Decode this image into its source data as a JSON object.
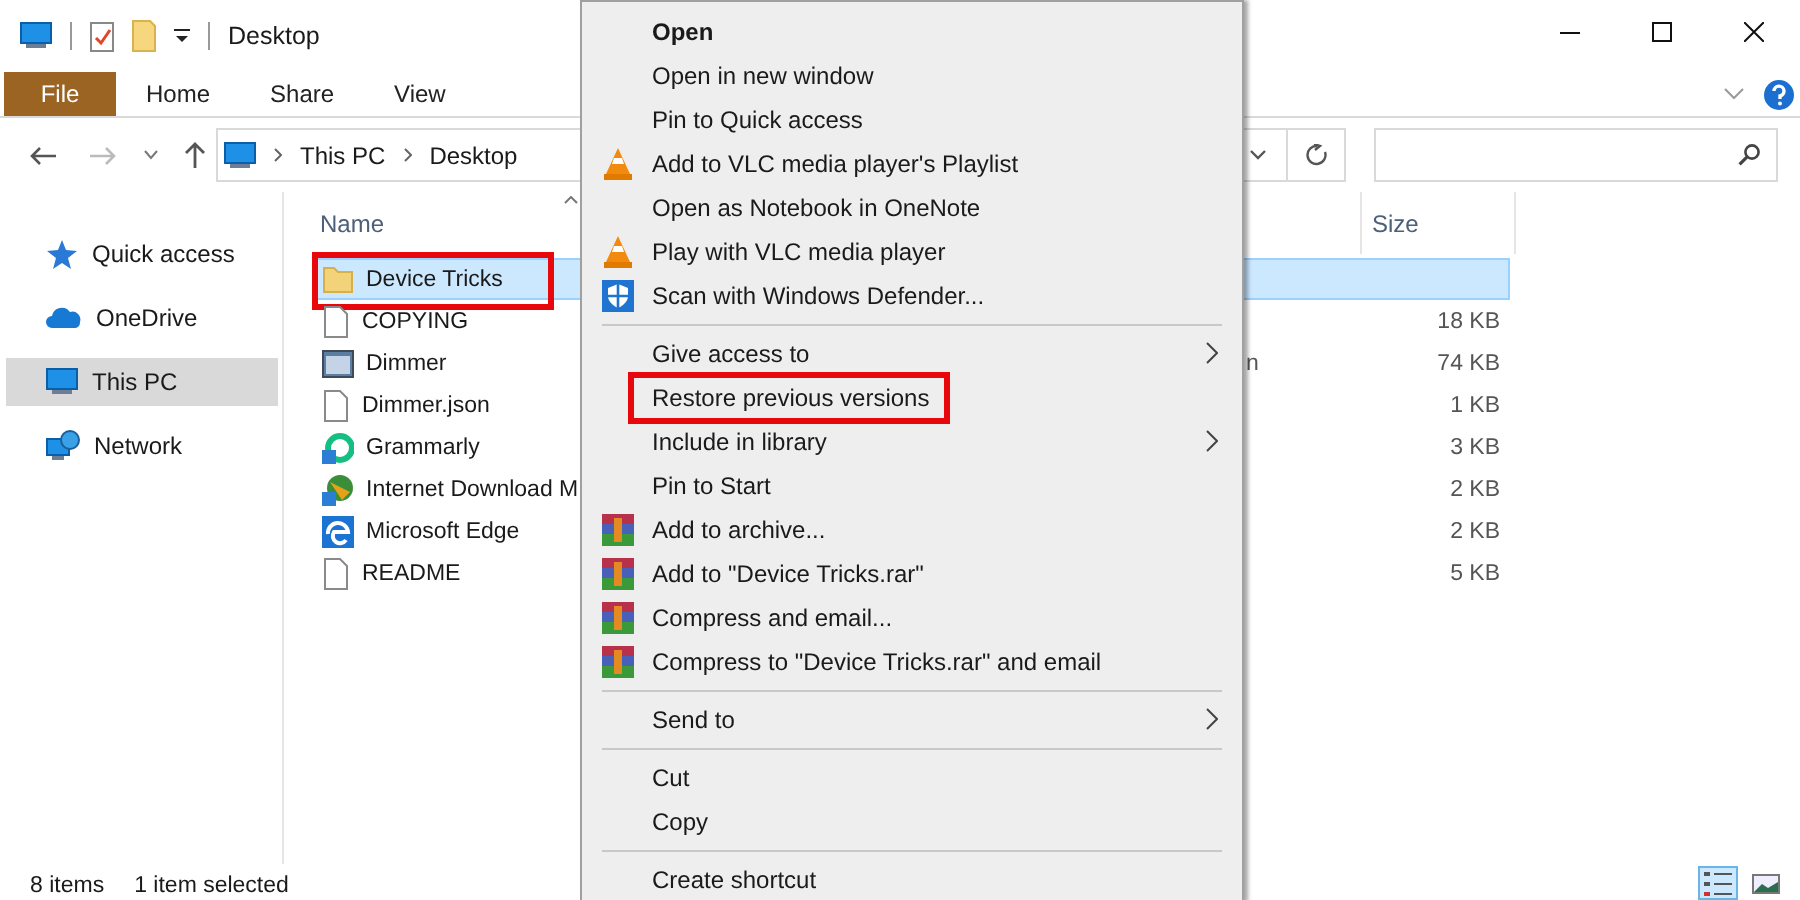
{
  "window": {
    "title": "Desktop"
  },
  "ribbon_tabs": [
    {
      "label": "File",
      "kind": "file"
    },
    {
      "label": "Home",
      "kind": "tab"
    },
    {
      "label": "Share",
      "kind": "tab"
    },
    {
      "label": "View",
      "kind": "tab"
    }
  ],
  "address": {
    "path": [
      "This PC",
      "Desktop"
    ]
  },
  "navigation": [
    {
      "label": "Quick access",
      "kind": "star",
      "selected": false
    },
    {
      "label": "OneDrive",
      "kind": "cloud",
      "selected": false
    },
    {
      "label": "This PC",
      "kind": "pc",
      "selected": true
    },
    {
      "label": "Network",
      "kind": "network",
      "selected": false
    }
  ],
  "file_list": {
    "columns": [
      "Name",
      "Size"
    ],
    "rows": [
      {
        "name": "Device Tricks",
        "kind": "folder",
        "selected": true,
        "highlighted": true
      },
      {
        "name": "COPYING",
        "kind": "document",
        "size": "18 KB",
        "selected": false,
        "highlighted": false
      },
      {
        "name": "Dimmer",
        "kind": "application",
        "column_3": "n",
        "size": "74 KB",
        "selected": false,
        "highlighted": false
      },
      {
        "name": "Dimmer.json",
        "kind": "document",
        "size": "1 KB",
        "selected": false,
        "highlighted": false
      },
      {
        "name": "Grammarly",
        "kind": "grammarly",
        "size": "3 KB",
        "selected": false,
        "highlighted": false
      },
      {
        "name": "Internet Download M",
        "kind": "idm",
        "size": "2 KB",
        "selected": false,
        "highlighted": false
      },
      {
        "name": "Microsoft Edge",
        "kind": "edge",
        "size": "2 KB",
        "selected": false,
        "highlighted": false
      },
      {
        "name": "README",
        "kind": "document",
        "size": "5 KB",
        "selected": false,
        "highlighted": false
      }
    ]
  },
  "status_bar": {
    "item_count": "8 items",
    "selection": "1 item selected"
  },
  "context_menu": {
    "items": [
      {
        "kind": "item",
        "label": "Open",
        "default": true,
        "submenu": false,
        "highlighted": false
      },
      {
        "kind": "item",
        "label": "Open in new window",
        "default": false,
        "submenu": false,
        "highlighted": false
      },
      {
        "kind": "item",
        "label": "Pin to Quick access",
        "default": false,
        "submenu": false,
        "highlighted": false
      },
      {
        "kind": "vlc",
        "label": "Add to VLC media player's Playlist",
        "default": false,
        "submenu": false,
        "highlighted": false
      },
      {
        "kind": "item",
        "label": "Open as Notebook in OneNote",
        "default": false,
        "submenu": false,
        "highlighted": false
      },
      {
        "kind": "vlc",
        "label": "Play with VLC media player",
        "default": false,
        "submenu": false,
        "highlighted": false
      },
      {
        "kind": "defender",
        "label": "Scan with Windows Defender...",
        "default": false,
        "submenu": false,
        "highlighted": false
      },
      {
        "kind": "separator"
      },
      {
        "kind": "item",
        "label": "Give access to",
        "default": false,
        "submenu": true,
        "highlighted": false
      },
      {
        "kind": "item",
        "label": "Restore previous versions",
        "default": false,
        "submenu": false,
        "highlighted": true
      },
      {
        "kind": "item",
        "label": "Include in library",
        "default": false,
        "submenu": true,
        "highlighted": false
      },
      {
        "kind": "item",
        "label": "Pin to Start",
        "default": false,
        "submenu": false,
        "highlighted": false
      },
      {
        "kind": "winrar",
        "label": "Add to archive...",
        "default": false,
        "submenu": false,
        "highlighted": false
      },
      {
        "kind": "winrar",
        "label": "Add to \"Device Tricks.rar\"",
        "default": false,
        "submenu": false,
        "highlighted": false
      },
      {
        "kind": "winrar",
        "label": "Compress and email...",
        "default": false,
        "submenu": false,
        "highlighted": false
      },
      {
        "kind": "winrar",
        "label": "Compress to \"Device Tricks.rar\" and email",
        "default": false,
        "submenu": false,
        "highlighted": false
      },
      {
        "kind": "separator"
      },
      {
        "kind": "item",
        "label": "Send to",
        "default": false,
        "submenu": true,
        "highlighted": false
      },
      {
        "kind": "separator"
      },
      {
        "kind": "item",
        "label": "Cut",
        "default": false,
        "submenu": false,
        "highlighted": false
      },
      {
        "kind": "item",
        "label": "Copy",
        "default": false,
        "submenu": false,
        "highlighted": false
      },
      {
        "kind": "separator"
      },
      {
        "kind": "item",
        "label": "Create shortcut",
        "default": false,
        "submenu": false,
        "highlighted": false
      }
    ]
  }
}
